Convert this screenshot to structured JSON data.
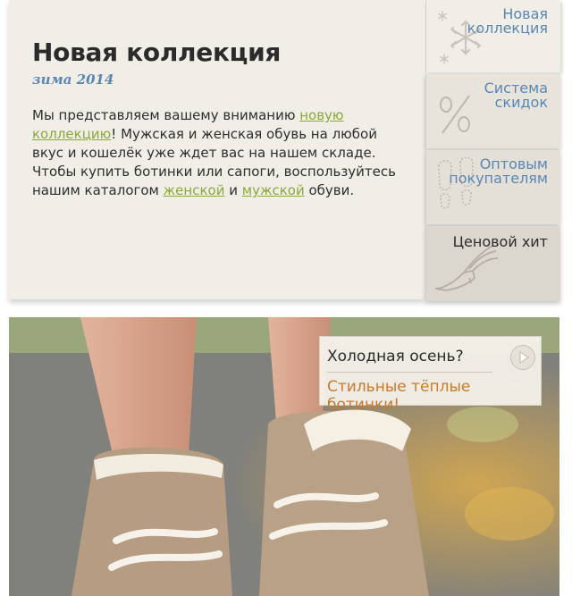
{
  "intro": {
    "title": "Новая коллекция",
    "season": "зима 2014",
    "text_1": "Мы представляем вашему вниманию ",
    "link_new": "новую коллекцию",
    "text_2": "! Мужская и женская обувь на любой вкус и кошелёк уже ждет вас на нашем складе. Чтобы купить ботинки или сапоги, воспользуйтесь нашим каталогом ",
    "link_women": "женской",
    "text_3": " и ",
    "link_men": "мужской",
    "text_4": " обуви."
  },
  "tabs": [
    {
      "line1": "Новая",
      "line2": "коллекция",
      "icon": "snowflake-icon"
    },
    {
      "line1": "Система",
      "line2": "скидок",
      "icon": "percent-icon"
    },
    {
      "line1": "Оптовым",
      "line2": "покупателям",
      "icon": "footprints-icon"
    },
    {
      "line1": "Ценовой хит",
      "line2": "",
      "icon": "winged-shoe-icon"
    }
  ],
  "promo": {
    "question": "Холодная осень?",
    "subtitle": "Стильные тёплые ботинки!"
  },
  "colors": {
    "panel_bg": "#f1eee8",
    "link": "#8aa83a",
    "tab_text": "#5a86b3",
    "promo_accent": "#c97a2c"
  }
}
